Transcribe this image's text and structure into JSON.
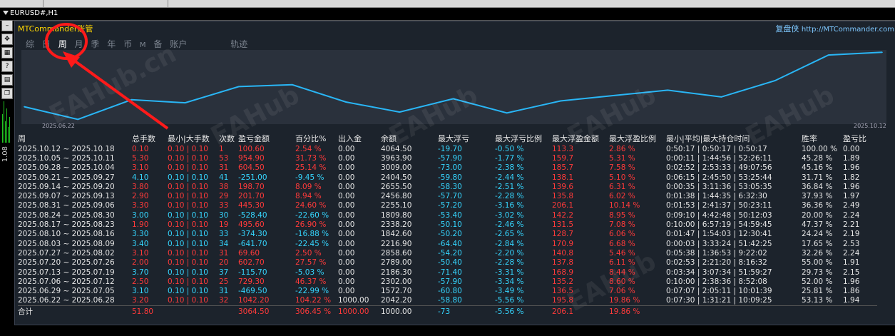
{
  "window": {
    "title": "EURUSD#,H1",
    "side_price": "1.08"
  },
  "toolbar_icons": [
    "minus-icon",
    "move-icon",
    "grid-icon",
    "help-icon",
    "grid2-icon",
    "copy-icon"
  ],
  "app": {
    "title": "MTCommander",
    "title_suffix": "账管",
    "brand_cn": "复盘侠",
    "brand_url": "http://MTCommander.com"
  },
  "tabs": [
    {
      "label": "综",
      "active": false
    },
    {
      "label": "日",
      "active": false
    },
    {
      "label": "周",
      "active": true
    },
    {
      "label": "月",
      "active": false
    },
    {
      "label": "季",
      "active": false
    },
    {
      "label": "年",
      "active": false
    },
    {
      "label": "币",
      "active": false
    },
    {
      "label": "M",
      "active": false
    },
    {
      "label": "备",
      "active": false
    },
    {
      "label": "账户",
      "active": false
    },
    {
      "label": "轨迹",
      "active": false
    }
  ],
  "chart_data": {
    "type": "line",
    "x": [
      "2025.06.22",
      "2025.06.29",
      "2025.07.06",
      "2025.07.13",
      "2025.07.20",
      "2025.07.27",
      "2025.08.03",
      "2025.08.10",
      "2025.08.17",
      "2025.08.24",
      "2025.08.31",
      "2025.09.07",
      "2025.09.14",
      "2025.09.21",
      "2025.09.28",
      "2025.10.05",
      "2025.10.12"
    ],
    "y": [
      2042.2,
      1572.7,
      2302.0,
      2186.3,
      2789.0,
      2858.6,
      2216.9,
      1842.6,
      2338.2,
      1809.8,
      2255.1,
      2456.8,
      2655.5,
      2404.5,
      3009.0,
      3963.9,
      4064.5
    ],
    "xlabels": [
      "2025.06.22",
      "2025.10.12"
    ],
    "color": "#29b6f6"
  },
  "table": {
    "headers": [
      "周",
      "总手数",
      "最小|大手数",
      "次数",
      "盈亏金额",
      "百分比%",
      "出入金",
      "余额",
      "最大浮亏",
      "最大浮亏比例",
      "最大浮盈金额",
      "最大浮盈比例",
      "最小|平均|最大持仓时间",
      "胜率",
      "盈亏比"
    ],
    "rows": [
      {
        "c": [
          "2025.10.12 ~ 2025.10.18",
          "0.10",
          "0.10 | 0.10",
          "1",
          "100.60",
          "2.54 %",
          "0.00",
          "4064.50",
          "-19.70",
          "-0.50 %",
          "113.3",
          "2.86 %",
          "0:50:17 | 0:50:17 | 0:50:17",
          "100.00 %",
          "0.00"
        ],
        "pos": true
      },
      {
        "c": [
          "2025.10.05 ~ 2025.10.11",
          "5.30",
          "0.10 | 0.10",
          "53",
          "954.90",
          "31.73 %",
          "0.00",
          "3963.90",
          "-57.90",
          "-1.77 %",
          "159.7",
          "5.31 %",
          "0:00:11 | 1:44:56 | 52:26:11",
          "45.28 %",
          "1.89"
        ],
        "pos": true
      },
      {
        "c": [
          "2025.09.28 ~ 2025.10.04",
          "3.10",
          "0.10 | 0.10",
          "31",
          "604.50",
          "25.14 %",
          "0.00",
          "3009.00",
          "-73.00",
          "-2.38 %",
          "185.7",
          "7.58 %",
          "0:02:52 | 2:53:33 | 49:07:56",
          "45.16 %",
          "1.96"
        ],
        "pos": true
      },
      {
        "c": [
          "2025.09.21 ~ 2025.09.27",
          "4.10",
          "0.10 | 0.10",
          "41",
          "-251.00",
          "-9.45 %",
          "0.00",
          "2404.50",
          "-59.80",
          "-2.44 %",
          "138.1",
          "5.10 %",
          "0:06:15 | 2:45:50 | 53:25:44",
          "31.71 %",
          "1.82"
        ],
        "pos": false
      },
      {
        "c": [
          "2025.09.14 ~ 2025.09.20",
          "3.80",
          "0.10 | 0.10",
          "38",
          "198.70",
          "8.09 %",
          "0.00",
          "2655.50",
          "-58.30",
          "-2.51 %",
          "139.6",
          "6.31 %",
          "0:00:35 | 3:11:36 | 53:05:35",
          "36.84 %",
          "1.96"
        ],
        "pos": true
      },
      {
        "c": [
          "2025.09.07 ~ 2025.09.13",
          "2.90",
          "0.10 | 0.10",
          "29",
          "201.70",
          "8.94 %",
          "0.00",
          "2456.80",
          "-57.70",
          "-2.28 %",
          "135.8",
          "6.02 %",
          "0:01:38 | 1:44:35 | 6:32:30",
          "37.93 %",
          "1.97"
        ],
        "pos": true
      },
      {
        "c": [
          "2025.08.31 ~ 2025.09.06",
          "3.30",
          "0.10 | 0.10",
          "33",
          "445.30",
          "24.60 %",
          "0.00",
          "2255.10",
          "-57.20",
          "-3.16 %",
          "206.1",
          "10.14 %",
          "0:01:53 | 2:41:37 | 50:23:11",
          "36.36 %",
          "2.49"
        ],
        "pos": true
      },
      {
        "c": [
          "2025.08.24 ~ 2025.08.30",
          "3.00",
          "0.10 | 0.10",
          "30",
          "-528.40",
          "-22.60 %",
          "0.00",
          "1809.80",
          "-53.40",
          "-3.02 %",
          "142.2",
          "8.95 %",
          "0:09:10 | 4:42:48 | 50:12:03",
          "20.00 %",
          "2.24"
        ],
        "pos": false
      },
      {
        "c": [
          "2025.08.17 ~ 2025.08.23",
          "1.90",
          "0.10 | 0.10",
          "19",
          "495.60",
          "26.90 %",
          "0.00",
          "2338.20",
          "-50.10",
          "-2.46 %",
          "131.5",
          "7.08 %",
          "0:10:00 | 6:57:19 | 54:59:45",
          "47.37 %",
          "2.21"
        ],
        "pos": true
      },
      {
        "c": [
          "2025.08.10 ~ 2025.08.16",
          "3.30",
          "0.10 | 0.10",
          "33",
          "-374.30",
          "-16.88 %",
          "0.00",
          "1842.60",
          "-50.20",
          "-2.65 %",
          "128.7",
          "6.06 %",
          "0:01:47 | 1:54:03 | 12:30:41",
          "24.24 %",
          "2.19"
        ],
        "pos": false
      },
      {
        "c": [
          "2025.08.03 ~ 2025.08.09",
          "3.40",
          "0.10 | 0.10",
          "34",
          "-641.70",
          "-22.45 %",
          "0.00",
          "2216.90",
          "-64.40",
          "-2.84 %",
          "170.9",
          "6.68 %",
          "0:00:03 | 3:33:24 | 51:42:25",
          "17.65 %",
          "2.53"
        ],
        "pos": false
      },
      {
        "c": [
          "2025.07.27 ~ 2025.08.02",
          "3.10",
          "0.10 | 0.10",
          "31",
          "69.60",
          "2.50 %",
          "0.00",
          "2858.60",
          "-54.20",
          "-2.20 %",
          "140.8",
          "5.46 %",
          "0:05:38 | 1:36:53 | 9:22:02",
          "32.26 %",
          "2.24"
        ],
        "pos": true
      },
      {
        "c": [
          "2025.07.20 ~ 2025.07.26",
          "2.00",
          "0.10 | 0.10",
          "20",
          "602.70",
          "27.57 %",
          "0.00",
          "2789.00",
          "-50.40",
          "-2.28 %",
          "137.8",
          "6.11 %",
          "0:02:53 | 2:21:20 | 8:16:32",
          "55.00 %",
          "1.91"
        ],
        "pos": true
      },
      {
        "c": [
          "2025.07.13 ~ 2025.07.19",
          "3.70",
          "0.10 | 0.10",
          "37",
          "-115.70",
          "-5.03 %",
          "0.00",
          "2186.30",
          "-71.40",
          "-3.31 %",
          "168.9",
          "8.44 %",
          "0:03:34 | 3:07:34 | 51:59:27",
          "29.73 %",
          "2.15"
        ],
        "pos": false
      },
      {
        "c": [
          "2025.07.06 ~ 2025.07.12",
          "2.50",
          "0.10 | 0.10",
          "25",
          "729.30",
          "46.37 %",
          "0.00",
          "2302.00",
          "-57.90",
          "-3.34 %",
          "135.2",
          "8.60 %",
          "0:10:00 | 2:38:36 | 8:52:08",
          "52.00 %",
          "1.96"
        ],
        "pos": true
      },
      {
        "c": [
          "2025.06.29 ~ 2025.07.05",
          "3.10",
          "0.10 | 0.10",
          "31",
          "-469.50",
          "-22.99 %",
          "0.00",
          "1572.70",
          "-60.80",
          "-3.49 %",
          "136.5",
          "7.06 %",
          "0:07:07 | 2:05:11 | 10:01:39",
          "25.81 %",
          "1.86"
        ],
        "pos": false
      },
      {
        "c": [
          "2025.06.22 ~ 2025.06.28",
          "3.20",
          "0.10 | 0.10",
          "32",
          "1042.20",
          "104.22 %",
          "1000.00",
          "2042.20",
          "-58.80",
          "-5.56 %",
          "195.8",
          "19.86 %",
          "0:07:30 | 1:31:21 | 10:09:25",
          "53.13 %",
          "1.94"
        ],
        "pos": true
      }
    ],
    "summary": {
      "label": "合计",
      "lots": "51.80",
      "pnl": "3064.50",
      "pct": "306.45 %",
      "deposit": "1000.00",
      "balance": "1000.00",
      "maxdd": "-73",
      "maxddpct": "-5.56 %",
      "maxprofit": "206.1",
      "maxprofitpct": "19.86 %"
    }
  },
  "watermarks": [
    "EAHub.cn",
    "EAHub",
    "EAHub",
    "EAHub",
    "EAHub",
    "EAHub"
  ]
}
